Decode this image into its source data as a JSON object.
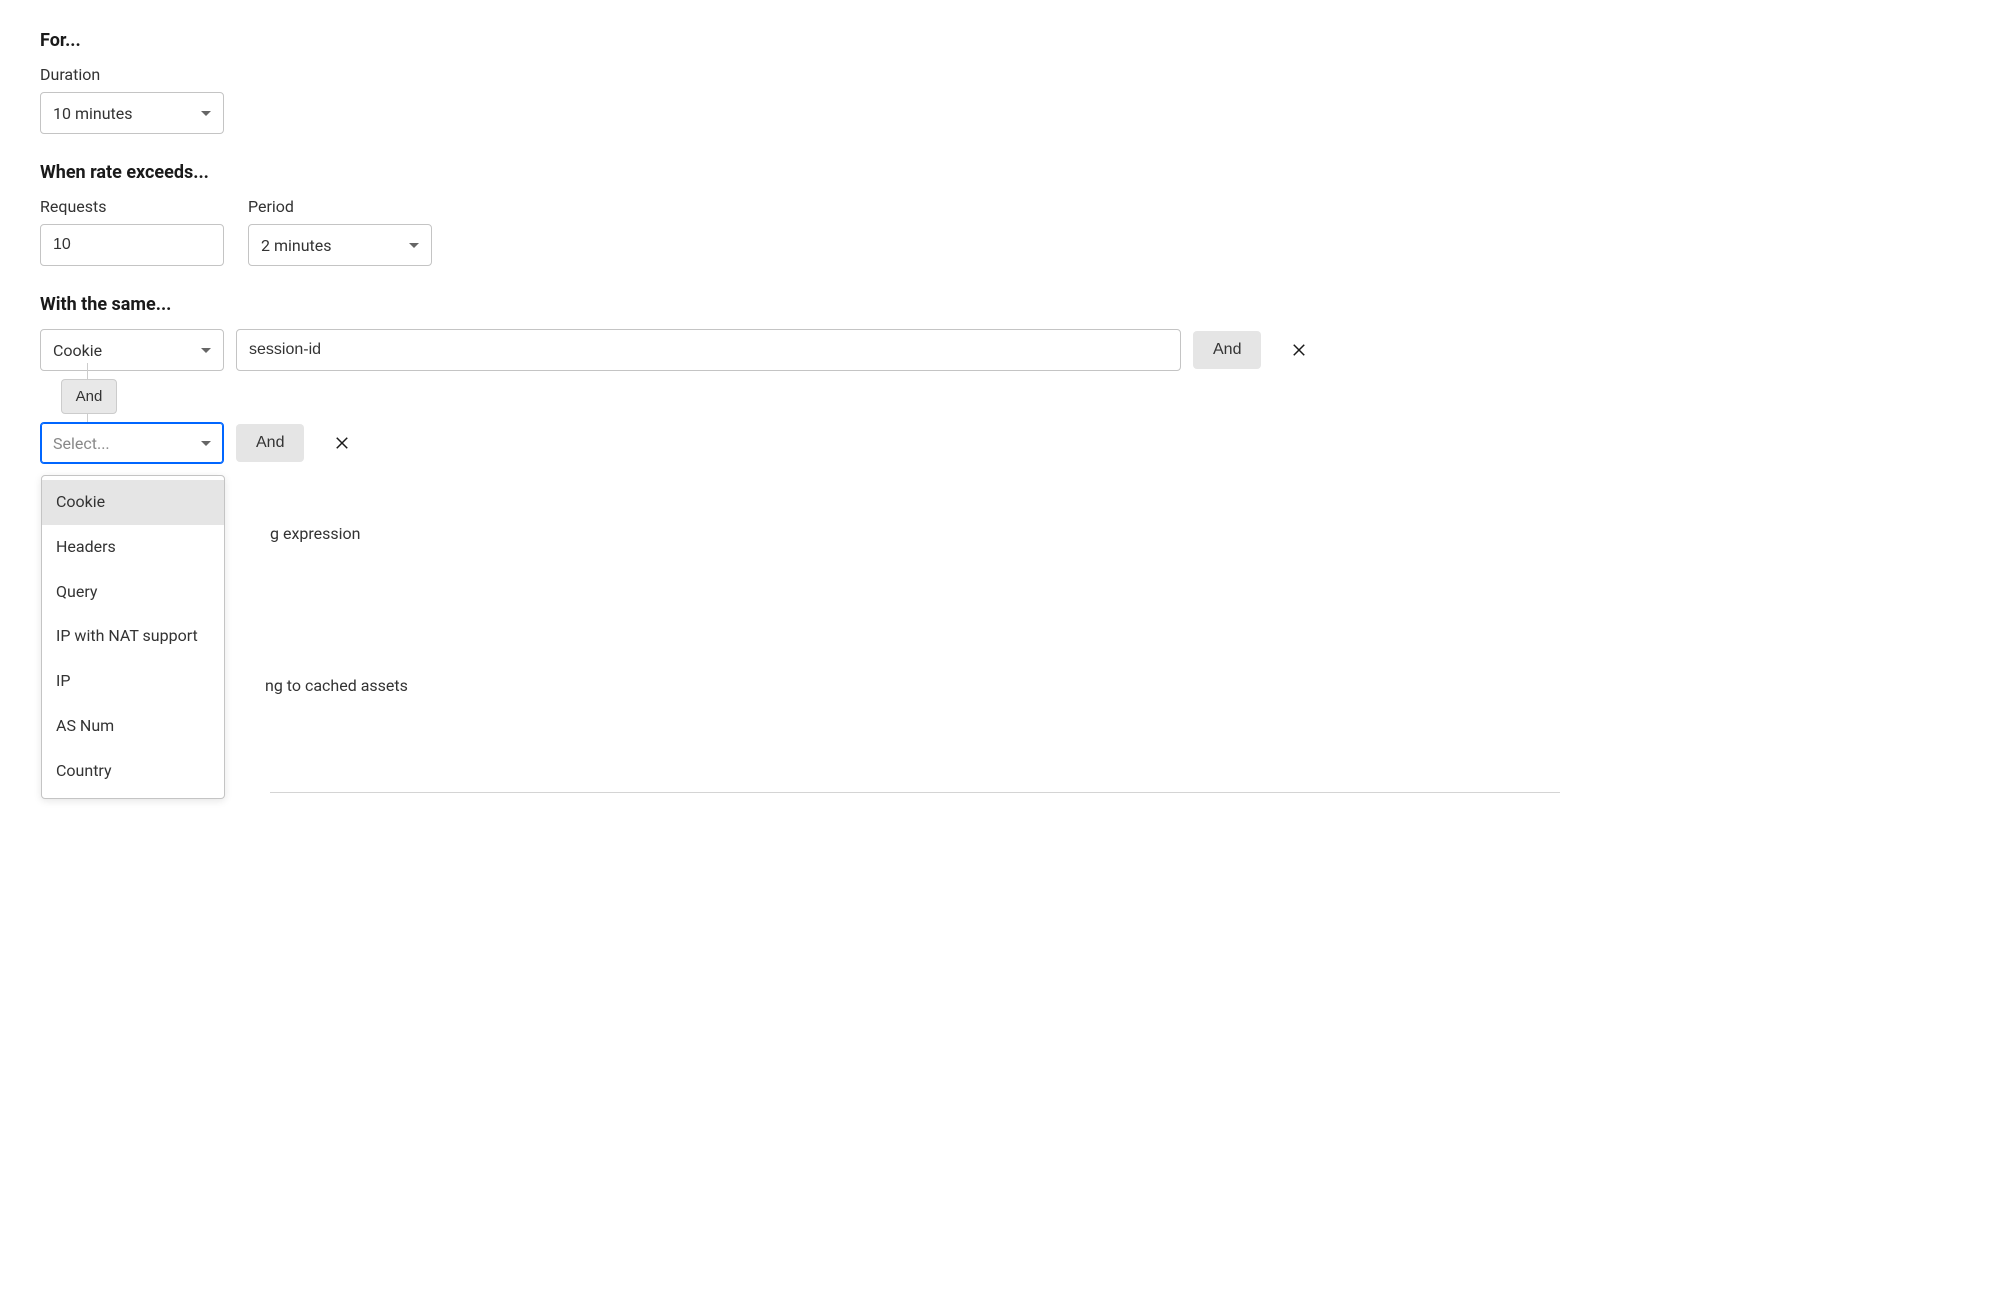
{
  "for_section": {
    "title": "For...",
    "duration_label": "Duration",
    "duration_value": "10 minutes"
  },
  "rate_section": {
    "title": "When rate exceeds...",
    "requests_label": "Requests",
    "requests_value": "10",
    "period_label": "Period",
    "period_value": "2 minutes"
  },
  "same_section": {
    "title": "With the same...",
    "row1": {
      "select_value": "Cookie",
      "input_value": "session-id",
      "and_label": "And"
    },
    "connector_and": "And",
    "row2": {
      "select_placeholder": "Select...",
      "and_label": "And"
    },
    "dropdown_options": [
      "Cookie",
      "Headers",
      "Query",
      "IP with NAT support",
      "IP",
      "AS Num",
      "Country"
    ]
  },
  "background": {
    "expression_text": "g expression",
    "cached_text": "ng to cached assets"
  }
}
